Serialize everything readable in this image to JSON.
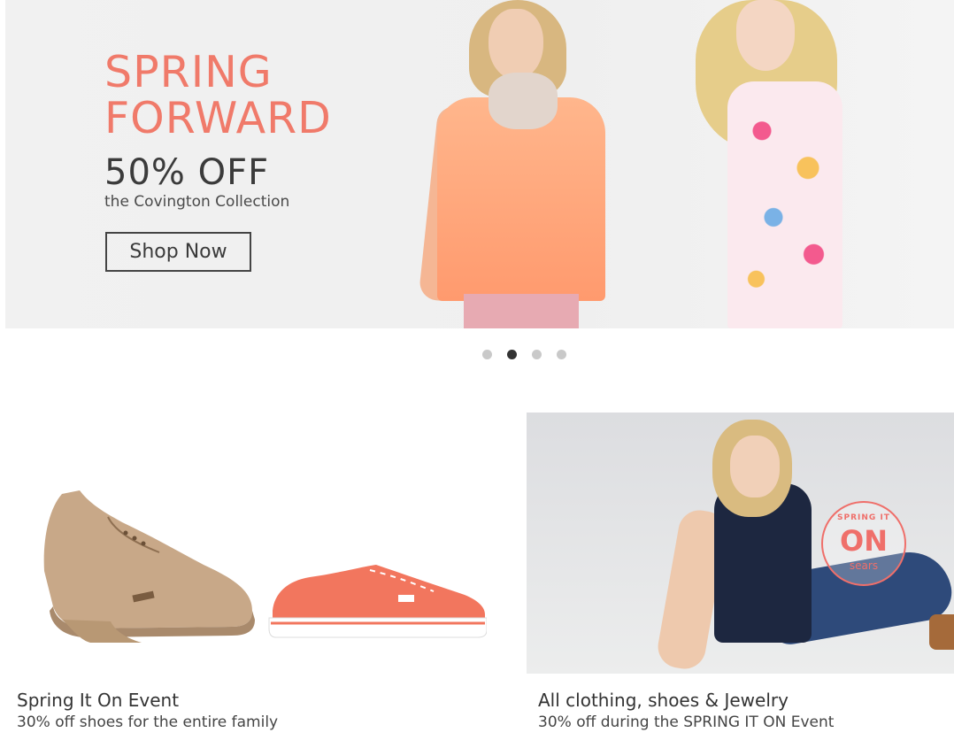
{
  "hero": {
    "title_line1": "SPRING",
    "title_line2": "FORWARD",
    "offer": "50% OFF",
    "subtitle": "the Covington Collection",
    "cta_label": "Shop Now",
    "accent_color": "#f07a6a"
  },
  "carousel": {
    "slide_count": 4,
    "active_index": 1
  },
  "promos": [
    {
      "title": "Spring It On Event",
      "description": "30% off shoes for the entire family",
      "image": "shoes-bootie-and-sneaker"
    },
    {
      "title": "All clothing, shoes & Jewelry",
      "description": "30% off during the SPRING IT ON Event",
      "image": "seated-model",
      "badge": {
        "top": "SPRING IT",
        "main": "ON",
        "brand": "sears"
      }
    }
  ]
}
